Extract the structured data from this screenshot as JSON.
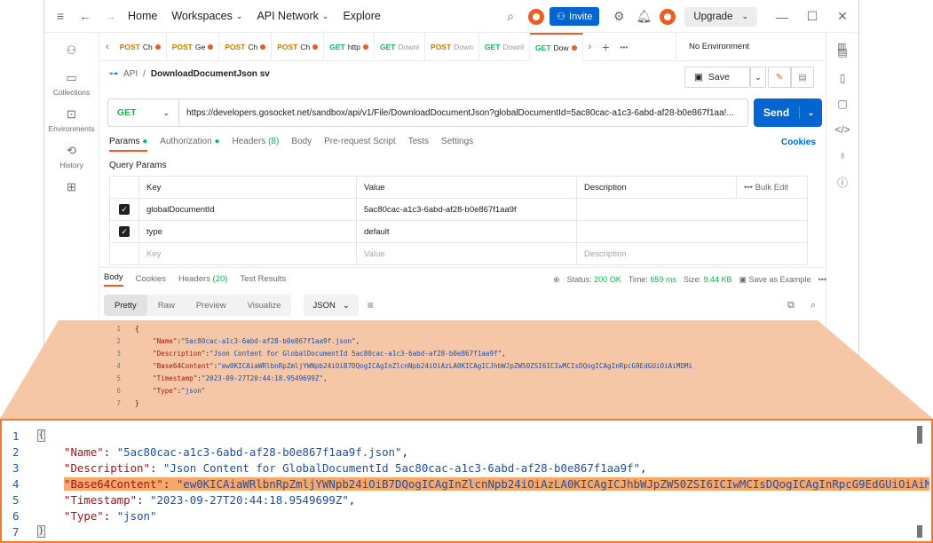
{
  "titlebar": {
    "home": "Home",
    "workspaces": "Workspaces",
    "api_network": "API Network",
    "explore": "Explore",
    "invite": "Invite",
    "upgrade": "Upgrade"
  },
  "sidebar": {
    "items": [
      {
        "label": "",
        "icon": "team-icon"
      },
      {
        "label": "Collections",
        "icon": "collections-icon"
      },
      {
        "label": "Environments",
        "icon": "environments-icon"
      },
      {
        "label": "History",
        "icon": "history-icon"
      },
      {
        "label": "",
        "icon": "apps-icon"
      }
    ]
  },
  "tabs": [
    {
      "method": "POST",
      "name": "Ch",
      "color": "#c77f00"
    },
    {
      "method": "POST",
      "name": "Ge",
      "color": "#c77f00"
    },
    {
      "method": "POST",
      "name": "Ch",
      "color": "#c77f00"
    },
    {
      "method": "POST",
      "name": "Ch",
      "color": "#c77f00"
    },
    {
      "method": "GET",
      "name": "http",
      "color": "#0cbb52"
    },
    {
      "method": "GET",
      "name": "Downl",
      "color": "#0cbb52"
    },
    {
      "method": "POST",
      "name": "Down",
      "color": "#c77f00"
    },
    {
      "method": "GET",
      "name": "Downl",
      "color": "#0cbb52"
    },
    {
      "method": "GET",
      "name": "Dow",
      "color": "#0cbb52"
    }
  ],
  "environment": "No Environment",
  "breadcrumb": {
    "root": "API",
    "separator": "/",
    "name": "DownloadDocumentJson sv"
  },
  "save_label": "Save",
  "request": {
    "method": "GET",
    "url": "https://developers.gosocket.net/sandbox/api/v1/File/DownloadDocumentJson?globalDocumentId=5ac80cac-a1c3-6abd-af28-b0e867f1aa!...",
    "send": "Send"
  },
  "request_tabs": {
    "params": "Params",
    "authorization": "Authorization",
    "headers": "Headers",
    "headers_count": "(8)",
    "body": "Body",
    "prerequest": "Pre-request Script",
    "tests": "Tests",
    "settings": "Settings",
    "cookies": "Cookies"
  },
  "query_params": {
    "title": "Query Params",
    "headers": {
      "key": "Key",
      "value": "Value",
      "description": "Description",
      "bulk": "Bulk Edit"
    },
    "rows": [
      {
        "key": "globalDocumentId",
        "value": "5ac80cac-a1c3-6abd-af28-b0e867f1aa9f",
        "description": ""
      },
      {
        "key": "type",
        "value": "default",
        "description": ""
      }
    ],
    "placeholder": {
      "key": "Key",
      "value": "Value",
      "description": "Description"
    }
  },
  "response": {
    "tabs": {
      "body": "Body",
      "cookies": "Cookies",
      "headers": "Headers",
      "headers_count": "(20)",
      "results": "Test Results"
    },
    "status_label": "Status:",
    "status": "200 OK",
    "time_label": "Time:",
    "time": "659 ms",
    "size_label": "Size:",
    "size": "9.44 KB",
    "save_example": "Save as Example",
    "views": [
      "Pretty",
      "Raw",
      "Preview",
      "Visualize"
    ],
    "format": "JSON"
  },
  "code": {
    "line_numbers": [
      "1",
      "2",
      "3",
      "4",
      "5",
      "6",
      "7"
    ],
    "open": "{",
    "close": "}",
    "name_key": "\"Name\"",
    "name_val": "\"5ac80cac-a1c3-6abd-af28-b0e867f1aa9f.json\"",
    "desc_key": "\"Description\"",
    "desc_val": "\"Json Content for GlobalDocumentId 5ac80cac-a1c3-6abd-af28-b0e867f1aa9f\"",
    "b64_key": "\"Base64Content\"",
    "b64_val": "\"ew0KICAiaWRlbnRpZmljYWNpb24iOiB7DQogICAgInZlcnNpb24iOiAzLA0KICAgICJhbWJpZW50ZSI6ICIwMCIsDQogICAgInRpcG9EdGUiOiAiMDMi",
    "ts_key": "\"Timestamp\"",
    "ts_val": "\"2023-09-27T20:44:18.9549699Z\"",
    "type_key": "\"Type\"",
    "type_val": "\"json\"",
    "colon": ": ",
    "comma": ","
  }
}
